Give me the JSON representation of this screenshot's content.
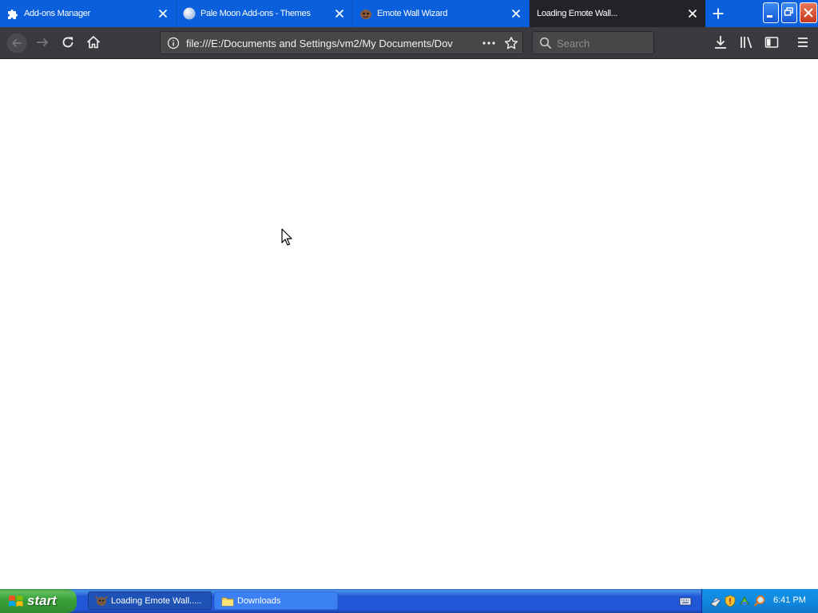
{
  "browser": {
    "tabs": [
      {
        "label": "Add-ons Manager",
        "icon": "puzzle-icon",
        "active": false
      },
      {
        "label": "Pale Moon Add-ons - Themes",
        "icon": "pale-moon-icon",
        "active": false
      },
      {
        "label": "Emote Wall Wizard",
        "icon": "emote-icon",
        "active": false
      },
      {
        "label": "Loading Emote Wall...",
        "icon": "",
        "active": true
      }
    ],
    "url": "file:///E:/Documents and Settings/vm2/My Documents/Dov",
    "search_placeholder": "Search"
  },
  "taskbar": {
    "start_label": "start",
    "tasks": [
      {
        "label": "Loading Emote Wall.....",
        "icon": "firefox-icon",
        "pressed": true
      },
      {
        "label": "Downloads",
        "icon": "folder-icon",
        "pressed": false
      }
    ],
    "clock": "6:41 PM"
  },
  "colors": {
    "tabstrip": "#0a5fdc",
    "active_tab": "#232327",
    "navbar": "#3a3a3e",
    "taskbar": "#2157d7",
    "start_button": "#38a138"
  }
}
